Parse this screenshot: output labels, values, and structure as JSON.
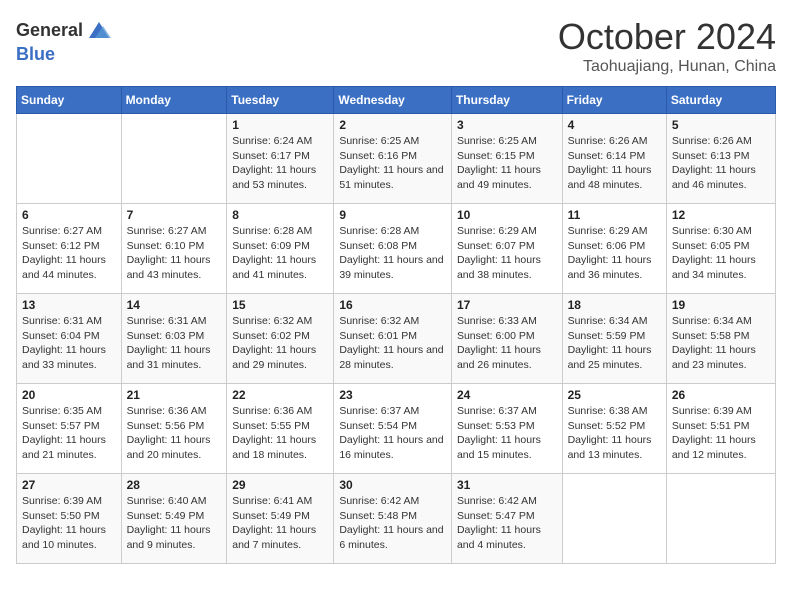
{
  "header": {
    "logo_general": "General",
    "logo_blue": "Blue",
    "month": "October 2024",
    "location": "Taohuajiang, Hunan, China"
  },
  "weekdays": [
    "Sunday",
    "Monday",
    "Tuesday",
    "Wednesday",
    "Thursday",
    "Friday",
    "Saturday"
  ],
  "weeks": [
    [
      {
        "day": "",
        "info": ""
      },
      {
        "day": "",
        "info": ""
      },
      {
        "day": "1",
        "info": "Sunrise: 6:24 AM\nSunset: 6:17 PM\nDaylight: 11 hours and 53 minutes."
      },
      {
        "day": "2",
        "info": "Sunrise: 6:25 AM\nSunset: 6:16 PM\nDaylight: 11 hours and 51 minutes."
      },
      {
        "day": "3",
        "info": "Sunrise: 6:25 AM\nSunset: 6:15 PM\nDaylight: 11 hours and 49 minutes."
      },
      {
        "day": "4",
        "info": "Sunrise: 6:26 AM\nSunset: 6:14 PM\nDaylight: 11 hours and 48 minutes."
      },
      {
        "day": "5",
        "info": "Sunrise: 6:26 AM\nSunset: 6:13 PM\nDaylight: 11 hours and 46 minutes."
      }
    ],
    [
      {
        "day": "6",
        "info": "Sunrise: 6:27 AM\nSunset: 6:12 PM\nDaylight: 11 hours and 44 minutes."
      },
      {
        "day": "7",
        "info": "Sunrise: 6:27 AM\nSunset: 6:10 PM\nDaylight: 11 hours and 43 minutes."
      },
      {
        "day": "8",
        "info": "Sunrise: 6:28 AM\nSunset: 6:09 PM\nDaylight: 11 hours and 41 minutes."
      },
      {
        "day": "9",
        "info": "Sunrise: 6:28 AM\nSunset: 6:08 PM\nDaylight: 11 hours and 39 minutes."
      },
      {
        "day": "10",
        "info": "Sunrise: 6:29 AM\nSunset: 6:07 PM\nDaylight: 11 hours and 38 minutes."
      },
      {
        "day": "11",
        "info": "Sunrise: 6:29 AM\nSunset: 6:06 PM\nDaylight: 11 hours and 36 minutes."
      },
      {
        "day": "12",
        "info": "Sunrise: 6:30 AM\nSunset: 6:05 PM\nDaylight: 11 hours and 34 minutes."
      }
    ],
    [
      {
        "day": "13",
        "info": "Sunrise: 6:31 AM\nSunset: 6:04 PM\nDaylight: 11 hours and 33 minutes."
      },
      {
        "day": "14",
        "info": "Sunrise: 6:31 AM\nSunset: 6:03 PM\nDaylight: 11 hours and 31 minutes."
      },
      {
        "day": "15",
        "info": "Sunrise: 6:32 AM\nSunset: 6:02 PM\nDaylight: 11 hours and 29 minutes."
      },
      {
        "day": "16",
        "info": "Sunrise: 6:32 AM\nSunset: 6:01 PM\nDaylight: 11 hours and 28 minutes."
      },
      {
        "day": "17",
        "info": "Sunrise: 6:33 AM\nSunset: 6:00 PM\nDaylight: 11 hours and 26 minutes."
      },
      {
        "day": "18",
        "info": "Sunrise: 6:34 AM\nSunset: 5:59 PM\nDaylight: 11 hours and 25 minutes."
      },
      {
        "day": "19",
        "info": "Sunrise: 6:34 AM\nSunset: 5:58 PM\nDaylight: 11 hours and 23 minutes."
      }
    ],
    [
      {
        "day": "20",
        "info": "Sunrise: 6:35 AM\nSunset: 5:57 PM\nDaylight: 11 hours and 21 minutes."
      },
      {
        "day": "21",
        "info": "Sunrise: 6:36 AM\nSunset: 5:56 PM\nDaylight: 11 hours and 20 minutes."
      },
      {
        "day": "22",
        "info": "Sunrise: 6:36 AM\nSunset: 5:55 PM\nDaylight: 11 hours and 18 minutes."
      },
      {
        "day": "23",
        "info": "Sunrise: 6:37 AM\nSunset: 5:54 PM\nDaylight: 11 hours and 16 minutes."
      },
      {
        "day": "24",
        "info": "Sunrise: 6:37 AM\nSunset: 5:53 PM\nDaylight: 11 hours and 15 minutes."
      },
      {
        "day": "25",
        "info": "Sunrise: 6:38 AM\nSunset: 5:52 PM\nDaylight: 11 hours and 13 minutes."
      },
      {
        "day": "26",
        "info": "Sunrise: 6:39 AM\nSunset: 5:51 PM\nDaylight: 11 hours and 12 minutes."
      }
    ],
    [
      {
        "day": "27",
        "info": "Sunrise: 6:39 AM\nSunset: 5:50 PM\nDaylight: 11 hours and 10 minutes."
      },
      {
        "day": "28",
        "info": "Sunrise: 6:40 AM\nSunset: 5:49 PM\nDaylight: 11 hours and 9 minutes."
      },
      {
        "day": "29",
        "info": "Sunrise: 6:41 AM\nSunset: 5:49 PM\nDaylight: 11 hours and 7 minutes."
      },
      {
        "day": "30",
        "info": "Sunrise: 6:42 AM\nSunset: 5:48 PM\nDaylight: 11 hours and 6 minutes."
      },
      {
        "day": "31",
        "info": "Sunrise: 6:42 AM\nSunset: 5:47 PM\nDaylight: 11 hours and 4 minutes."
      },
      {
        "day": "",
        "info": ""
      },
      {
        "day": "",
        "info": ""
      }
    ]
  ]
}
